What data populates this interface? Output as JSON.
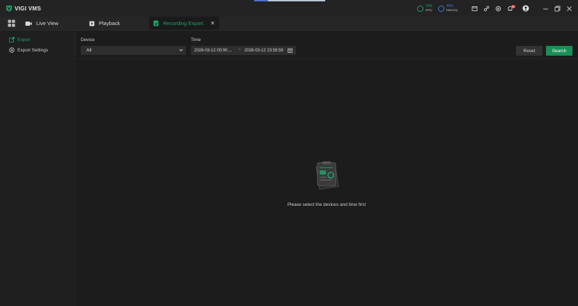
{
  "app": {
    "title": "VIGI VMS"
  },
  "status": {
    "cpu": {
      "value": "13%",
      "label": "CPU"
    },
    "memory": {
      "value": "40%",
      "label": "Memory"
    },
    "notification_count": "99"
  },
  "tabs": [
    {
      "label": "Live View"
    },
    {
      "label": "Playback"
    },
    {
      "label": "Recording Export"
    }
  ],
  "sidebar": {
    "items": [
      {
        "label": "Export"
      },
      {
        "label": "Export Settings"
      }
    ]
  },
  "filters": {
    "device_label": "Device",
    "device_value": "All",
    "time_label": "Time",
    "time_start": "2026-03-12 00:00:...",
    "time_separator": "~",
    "time_end": "2026-03-12 23:59:59"
  },
  "buttons": {
    "reset": "Reset",
    "search": "Search"
  },
  "empty_state": {
    "message": "Please select the devices and time first"
  },
  "colors": {
    "accent": "#1fa36a",
    "search_button": "#1a8f55",
    "badge": "#e03a3a"
  }
}
